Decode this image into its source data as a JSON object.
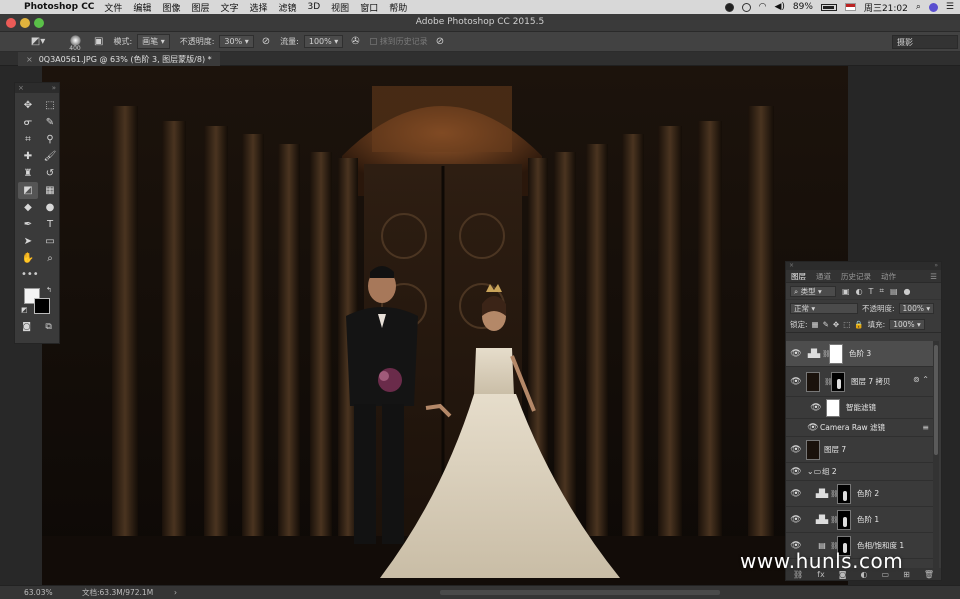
{
  "menubar": {
    "app_name": "Photoshop CC",
    "items": [
      "文件",
      "编辑",
      "图像",
      "图层",
      "文字",
      "选择",
      "滤镜",
      "3D",
      "视图",
      "窗口",
      "帮助"
    ],
    "battery": "89%",
    "clock": "周三21:02"
  },
  "window": {
    "title": "Adobe Photoshop CC 2015.5"
  },
  "options": {
    "brush_size": "400",
    "mode_label": "模式:",
    "mode_value": "画笔",
    "opacity_label": "不透明度:",
    "opacity_value": "30%",
    "flow_label": "流量:",
    "flow_value": "100%",
    "erase_history_label": "抹到历史记录",
    "workspace": "摄影"
  },
  "document": {
    "tab_title": "0Q3A0561.JPG @ 63% (色阶 3, 图层蒙版/8) *"
  },
  "tools": {
    "items": [
      {
        "name": "move-tool-icon",
        "glyph": "✥"
      },
      {
        "name": "marquee-tool-icon",
        "glyph": "⬚"
      },
      {
        "name": "lasso-tool-icon",
        "glyph": "ᓂ"
      },
      {
        "name": "quick-select-tool-icon",
        "glyph": "✎"
      },
      {
        "name": "crop-tool-icon",
        "glyph": "⌗"
      },
      {
        "name": "eyedropper-tool-icon",
        "glyph": "⚲"
      },
      {
        "name": "healing-brush-tool-icon",
        "glyph": "✚"
      },
      {
        "name": "brush-tool-icon",
        "glyph": "🖌"
      },
      {
        "name": "clone-stamp-tool-icon",
        "glyph": "♜"
      },
      {
        "name": "history-brush-tool-icon",
        "glyph": "↺"
      },
      {
        "name": "eraser-tool-icon",
        "glyph": "◩",
        "active": true
      },
      {
        "name": "gradient-tool-icon",
        "glyph": "▦"
      },
      {
        "name": "blur-tool-icon",
        "glyph": "◆"
      },
      {
        "name": "dodge-tool-icon",
        "glyph": "●"
      },
      {
        "name": "pen-tool-icon",
        "glyph": "✒"
      },
      {
        "name": "type-tool-icon",
        "glyph": "T"
      },
      {
        "name": "path-select-tool-icon",
        "glyph": "➤"
      },
      {
        "name": "shape-tool-icon",
        "glyph": "▭"
      },
      {
        "name": "hand-tool-icon",
        "glyph": "✋"
      },
      {
        "name": "zoom-tool-icon",
        "glyph": "⌕"
      }
    ],
    "more_glyph": "•••",
    "foreground_color": "#f4f4f4",
    "background_color": "#000000"
  },
  "layers_panel": {
    "tabs": [
      "图层",
      "通道",
      "历史记录",
      "动作"
    ],
    "filter_kind": "类型",
    "blend_mode": "正常",
    "opacity_label": "不透明度:",
    "opacity_value": "100%",
    "lock_label": "锁定:",
    "fill_label": "填充:",
    "fill_value": "100%",
    "layers": [
      {
        "name": "色阶 3",
        "type": "adjustment",
        "selected": true
      },
      {
        "name": "图层 7 拷贝",
        "type": "smart-object"
      },
      {
        "name": "智能滤镜",
        "type": "smart-filter"
      },
      {
        "name": "Camera Raw 滤镜",
        "type": "filter"
      },
      {
        "name": "图层 7",
        "type": "pixel"
      },
      {
        "name": "组 2",
        "type": "group"
      },
      {
        "name": "色阶 2",
        "type": "adjustment"
      },
      {
        "name": "色阶 1",
        "type": "adjustment"
      },
      {
        "name": "色相/饱和度 1",
        "type": "adjustment"
      }
    ]
  },
  "status": {
    "zoom": "63.03%",
    "doc_size": "文档:63.3M/972.1M"
  },
  "watermark": "www.hunls.com"
}
